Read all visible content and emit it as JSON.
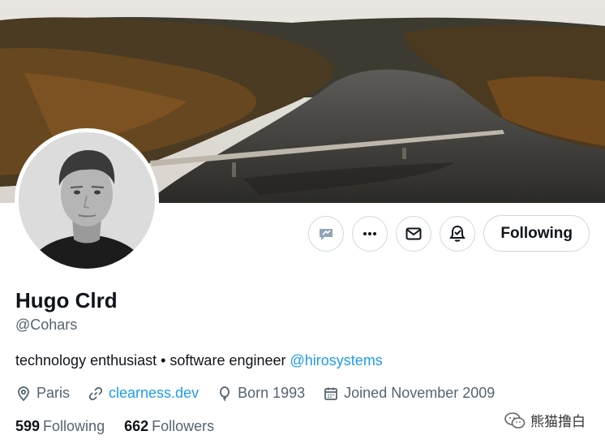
{
  "profile": {
    "name": "Hugo Clrd",
    "handle": "@Cohars",
    "bio_text": "technology enthusiast • software engineer ",
    "bio_mention": "@hirosystems",
    "location": "Paris",
    "website": "clearness.dev",
    "born": "Born 1993",
    "joined": "Joined November 2009"
  },
  "stats": {
    "following_count": "599",
    "following_label": "Following",
    "followers_count": "662",
    "followers_label": "Followers"
  },
  "actions": {
    "follow_label": "Following",
    "icons": [
      "grok-icon",
      "more-icon",
      "message-icon",
      "notification-bell-icon"
    ]
  },
  "watermark": {
    "text": "熊猫撸白"
  },
  "colors": {
    "accent": "#1d9bf0",
    "text": "#0f1419",
    "secondary": "#536471",
    "border": "#cfd9de"
  }
}
